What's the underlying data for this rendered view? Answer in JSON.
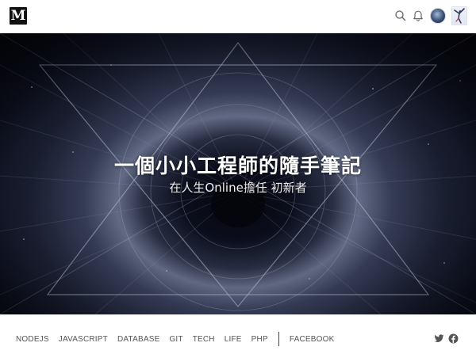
{
  "header": {
    "logo_text": "M",
    "icons": [
      "search-icon",
      "bell-icon",
      "avatar",
      "profile-thumbnail"
    ]
  },
  "hero": {
    "title": "一個小小工程師的隨手筆記",
    "subtitle": "在人生Online擔任 初新者"
  },
  "nav": {
    "items": [
      "NODEJS",
      "JAVASCRIPT",
      "DATABASE",
      "GIT",
      "TECH",
      "LIFE",
      "PHP"
    ],
    "extra_item": "FACEBOOK",
    "social_icons": [
      "twitter-icon",
      "facebook-icon"
    ]
  },
  "colors": {
    "hero_dark": "#0b0e1d",
    "hero_glow": "#6a7390",
    "nav_text": "#555555",
    "logo_bg": "#111111"
  }
}
